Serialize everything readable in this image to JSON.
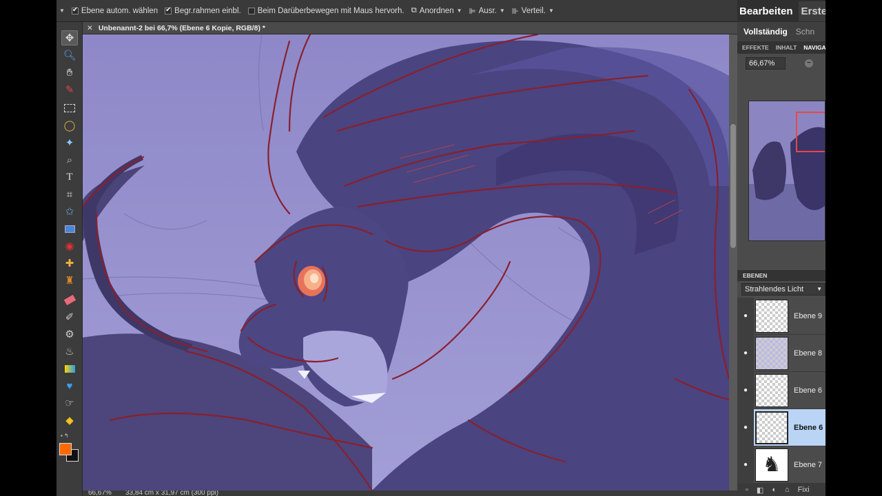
{
  "optbar": {
    "auto_select_label": "Ebene autom. wählen",
    "auto_select_checked": true,
    "bounding_box_label": "Begr.rahmen einbl.",
    "bounding_box_checked": true,
    "highlight_label": "Beim Darüberbewegen mit Maus hervorh.",
    "highlight_checked": false,
    "arrange_label": "Anordnen",
    "align_label": "Ausr.",
    "distribute_label": "Verteil."
  },
  "tools": [
    "move-icon",
    "zoom-icon",
    "hand-icon",
    "eyedropper-icon",
    "marquee-icon",
    "lasso-icon",
    "magic-wand-icon",
    "quick-selection-icon",
    "type-icon",
    "crop-icon",
    "cookie-cutter-icon",
    "straighten-icon",
    "red-eye-icon",
    "healing-brush-icon",
    "clone-stamp-icon",
    "eraser-icon",
    "brush-icon",
    "smart-brush-icon",
    "paint-bucket-icon",
    "gradient-icon",
    "custom-shape-icon",
    "blur-icon",
    "sponge-icon"
  ],
  "colors": {
    "foreground": "#ff6a00",
    "background": "#111111",
    "canvas_sky": "#8f89c6",
    "creature": "#4a4478",
    "lines": "#8a1f2c"
  },
  "document": {
    "tab_title": "Unbenannt-2 bei 66,7% (Ebene 6 Kopie, RGB/8) *",
    "zoom": "66,67%",
    "dimensions": "33,84 cm x 31,97 cm (300 ppi)"
  },
  "panel": {
    "tab_edit": "Bearbeiten",
    "tab_create": "Erste",
    "sub_full": "Vollständig",
    "sub_quick": "Schn",
    "palette_effects": "EFFEKTE",
    "palette_content": "INHALT",
    "palette_navigator": "NAVIGA",
    "nav_zoom": "66,67%",
    "layers_title": "EBENEN",
    "blend_mode": "Strahlendes Licht",
    "bottom_label": "Fixi"
  },
  "layers": [
    {
      "name": "Ebene 9",
      "selected": false,
      "thumb": "checker"
    },
    {
      "name": "Ebene 8",
      "selected": false,
      "thumb": "lavender"
    },
    {
      "name": "Ebene 6",
      "selected": false,
      "thumb": "checker"
    },
    {
      "name": "Ebene 6",
      "selected": true,
      "thumb": "checker"
    },
    {
      "name": "Ebene 7",
      "selected": false,
      "thumb": "silhouette"
    }
  ]
}
